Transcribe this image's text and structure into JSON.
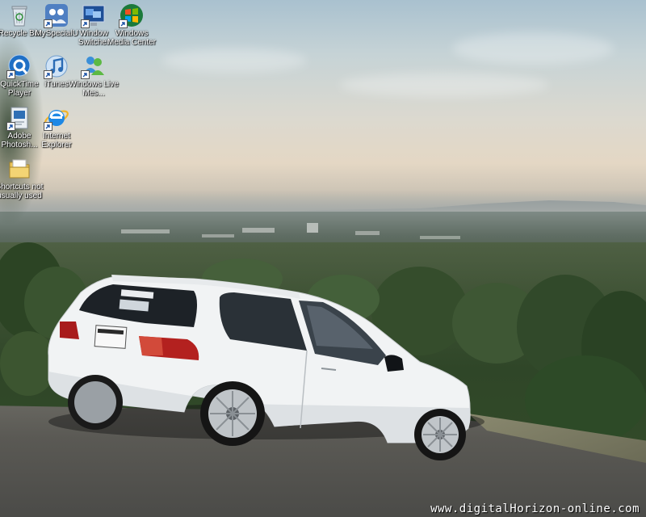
{
  "desktop": {
    "icons": [
      {
        "label": "Recycle Bin",
        "icon": "recycle-bin-icon",
        "shortcut": false
      },
      {
        "label": "MySpecialU",
        "icon": "myspecialu-icon",
        "shortcut": true
      },
      {
        "label": "Window Switcher",
        "icon": "window-switcher-icon",
        "shortcut": true
      },
      {
        "label": "Windows Media Center",
        "icon": "windows-media-center-icon",
        "shortcut": true
      },
      {
        "label": "QuickTime Player",
        "icon": "quicktime-icon",
        "shortcut": true
      },
      {
        "label": "iTunes",
        "icon": "itunes-icon",
        "shortcut": true
      },
      {
        "label": "Windows Live Mes...",
        "icon": "windows-live-messenger-icon",
        "shortcut": true
      },
      {
        "label": "Adobe Photosh...",
        "icon": "photoshop-icon",
        "shortcut": true
      },
      {
        "label": "Internet Explorer",
        "icon": "internet-explorer-icon",
        "shortcut": true
      },
      {
        "label": "Shortcuts not usually used",
        "icon": "folder-icon",
        "shortcut": false
      }
    ]
  },
  "wallpaper": {
    "watermark": "www.digitalHorizon-online.com"
  },
  "colors": {
    "icon_label_text": "#ffffff",
    "icon_label_shadow": "#000000",
    "car_body": "#f2f4f5"
  }
}
